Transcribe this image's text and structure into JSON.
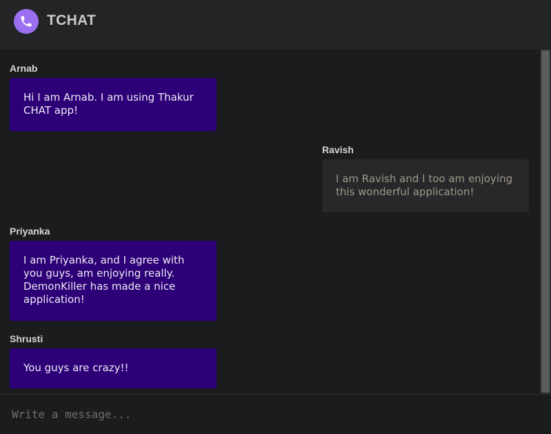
{
  "app": {
    "title": "TCHAT",
    "logo_icon": "phone-icon",
    "accent": "#9a6ff0"
  },
  "messages": [
    {
      "sender": "Arnab",
      "text": "Hi I am Arnab. I am using Thakur CHAT app!",
      "mine": true
    },
    {
      "sender": "Ravish",
      "text": "I am Ravish and I too am enjoying this wonderful application!",
      "mine": false
    },
    {
      "sender": "Priyanka",
      "text": "I am Priyanka, and I agree with you guys, am enjoying really. DemonKiller has made a nice application!",
      "mine": true
    },
    {
      "sender": "Shrusti",
      "text": "You guys are crazy!!",
      "mine": true
    }
  ],
  "composer": {
    "placeholder": "Write a message..."
  },
  "colors": {
    "own_bubble": "#2d0078",
    "other_bubble": "#27282a"
  }
}
